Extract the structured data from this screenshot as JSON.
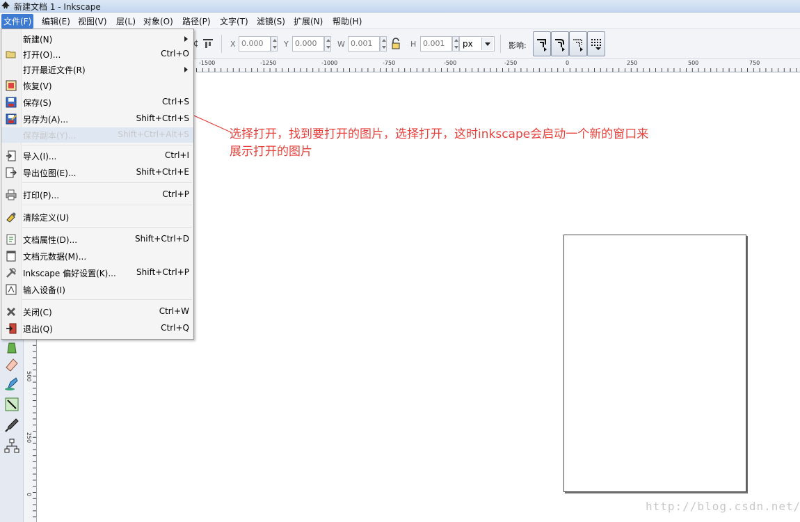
{
  "window": {
    "title": "新建文档 1 - Inkscape",
    "app_icon": "inkscape-icon"
  },
  "menubar": {
    "items": [
      "文件(F)",
      "编辑(E)",
      "视图(V)",
      "层(L)",
      "对象(O)",
      "路径(P)",
      "文字(T)",
      "滤镜(S)",
      "扩展(N)",
      "帮助(H)"
    ],
    "active_index": 0
  },
  "toolbar": {
    "x_label": "X",
    "x_value": "0.000",
    "y_label": "Y",
    "y_value": "0.000",
    "w_label": "W",
    "w_value": "0.001",
    "h_label": "H",
    "h_value": "0.001",
    "unit": "px",
    "affect_label": "影响:"
  },
  "ruler_top_labels": [
    "-1500",
    "-1250",
    "-1000",
    "-750",
    "-500",
    "-250",
    "0",
    "250",
    "500",
    "750"
  ],
  "ruler_left_labels": [
    "500",
    "250",
    "0"
  ],
  "file_menu": {
    "items": [
      {
        "label": "新建(N)",
        "shortcut": "",
        "submenu": true,
        "icon": "new-icon"
      },
      {
        "label": "打开(O)...",
        "shortcut": "Ctrl+O",
        "icon": "open-folder-icon"
      },
      {
        "label": "打开最近文件(R)",
        "shortcut": "",
        "submenu": true,
        "icon": ""
      },
      {
        "label": "恢复(V)",
        "shortcut": "",
        "icon": "revert-icon"
      },
      {
        "label": "保存(S)",
        "shortcut": "Ctrl+S",
        "icon": "save-icon"
      },
      {
        "label": "另存为(A)...",
        "shortcut": "Shift+Ctrl+S",
        "icon": "save-as-icon"
      },
      {
        "label": "保存副本(Y)...",
        "shortcut": "Shift+Ctrl+Alt+S",
        "icon": "",
        "disabled": true
      },
      {
        "label": "导入(I)...",
        "shortcut": "Ctrl+I",
        "icon": "import-icon"
      },
      {
        "label": "导出位图(E)...",
        "shortcut": "Shift+Ctrl+E",
        "icon": "export-bitmap-icon"
      },
      {
        "label": "打印(P)...",
        "shortcut": "Ctrl+P",
        "icon": "print-icon"
      },
      {
        "label": "清除定义(U)",
        "shortcut": "",
        "icon": "vacuum-defs-icon"
      },
      {
        "label": "文档属性(D)...",
        "shortcut": "Shift+Ctrl+D",
        "icon": "document-properties-icon"
      },
      {
        "label": "文档元数据(M)...",
        "shortcut": "",
        "icon": "document-metadata-icon"
      },
      {
        "label": "Inkscape 偏好设置(K)...",
        "shortcut": "Shift+Ctrl+P",
        "icon": "preferences-icon"
      },
      {
        "label": "输入设备(I)",
        "shortcut": "",
        "icon": "input-devices-icon"
      },
      {
        "label": "关闭(C)",
        "shortcut": "Ctrl+W",
        "icon": "close-icon"
      },
      {
        "label": "退出(Q)",
        "shortcut": "Ctrl+Q",
        "icon": "quit-icon"
      }
    ]
  },
  "annotation": {
    "line1": "选择打开，找到要打开的图片，选择打开，这时inkscape会启动一个新的窗口来",
    "line2": "展示打开的图片",
    "color": "#e8413c"
  },
  "watermark": "http://blog.csdn.net/"
}
